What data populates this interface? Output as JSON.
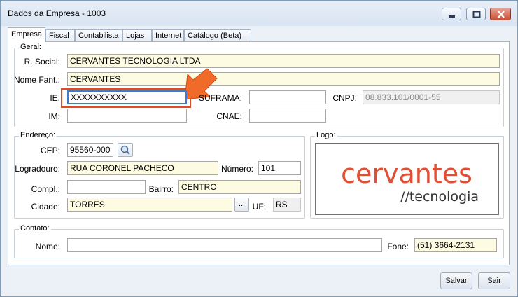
{
  "window": {
    "title": "Dados da Empresa - 1003"
  },
  "tabs": [
    {
      "label": "Empresa"
    },
    {
      "label": "Fiscal"
    },
    {
      "label": "Contabilista"
    },
    {
      "label": "Lojas"
    },
    {
      "label": "Internet"
    },
    {
      "label": "Catálogo (Beta)"
    }
  ],
  "geral": {
    "legend": "Geral:",
    "razao_social_label": "R. Social:",
    "razao_social_value": "CERVANTES TECNOLOGIA LTDA",
    "nome_fantasia_label": "Nome Fant.:",
    "nome_fantasia_value": "CERVANTES",
    "ie_label": "IE:",
    "ie_value": "XXXXXXXXXX",
    "suframa_label": "SUFRAMA:",
    "suframa_value": "",
    "cnpj_label": "CNPJ:",
    "cnpj_value": "08.833.101/0001-55",
    "im_label": "IM:",
    "im_value": "",
    "cnae_label": "CNAE:",
    "cnae_value": ""
  },
  "endereco": {
    "legend": "Endereço:",
    "cep_label": "CEP:",
    "cep_value": "95560-000",
    "logradouro_label": "Logradouro:",
    "logradouro_value": "RUA CORONEL PACHECO",
    "numero_label": "Número:",
    "numero_value": "101",
    "compl_label": "Compl.:",
    "compl_value": "",
    "bairro_label": "Bairro:",
    "bairro_value": "CENTRO",
    "cidade_label": "Cidade:",
    "cidade_value": "TORRES",
    "cidade_button": "...",
    "uf_label": "UF:",
    "uf_value": "RS"
  },
  "logo": {
    "legend": "Logo:",
    "brand": "cervantes",
    "tagline": "//tecnologia",
    "brand_color": "#e04e33"
  },
  "contato": {
    "legend": "Contato:",
    "nome_label": "Nome:",
    "nome_value": "",
    "fone_label": "Fone:",
    "fone_value": "(51) 3664-2131"
  },
  "footer": {
    "save_label": "Salvar",
    "exit_label": "Sair"
  },
  "annotation": {
    "highlight_color": "#e24a24"
  },
  "icons": {
    "search": "magnifier-icon",
    "minimize": "minimize-icon",
    "maximize": "maximize-icon",
    "close": "close-icon"
  }
}
